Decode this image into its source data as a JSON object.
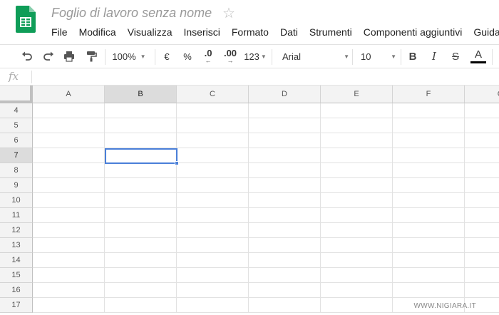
{
  "app": {
    "doc_title": "Foglio di lavoro senza nome",
    "star_glyph": "☆"
  },
  "menu": [
    "File",
    "Modifica",
    "Visualizza",
    "Inserisci",
    "Formato",
    "Dati",
    "Strumenti",
    "Componenti aggiuntivi",
    "Guida"
  ],
  "toolbar": {
    "zoom": "100%",
    "currency": "€",
    "percent": "%",
    "decimal_decrease": ".0",
    "decimal_increase": ".00",
    "more_formats": "123",
    "font": "Arial",
    "font_size": "10",
    "bold": "B",
    "italic": "I",
    "strikethrough": "S",
    "text_color": "A"
  },
  "formula_bar": {
    "fx_label": "fx",
    "value": ""
  },
  "sheet": {
    "columns": [
      "A",
      "B",
      "C",
      "D",
      "E",
      "F",
      "G"
    ],
    "rows": [
      "4",
      "5",
      "6",
      "7",
      "8",
      "9",
      "10",
      "11",
      "12",
      "13",
      "14",
      "15",
      "16",
      "17"
    ],
    "active_column": "B",
    "active_row": "7"
  },
  "watermark": "WWW.NIGIARA.IT",
  "colors": {
    "brand_green": "#0F9D58",
    "selection_blue": "#4A7FD8"
  }
}
